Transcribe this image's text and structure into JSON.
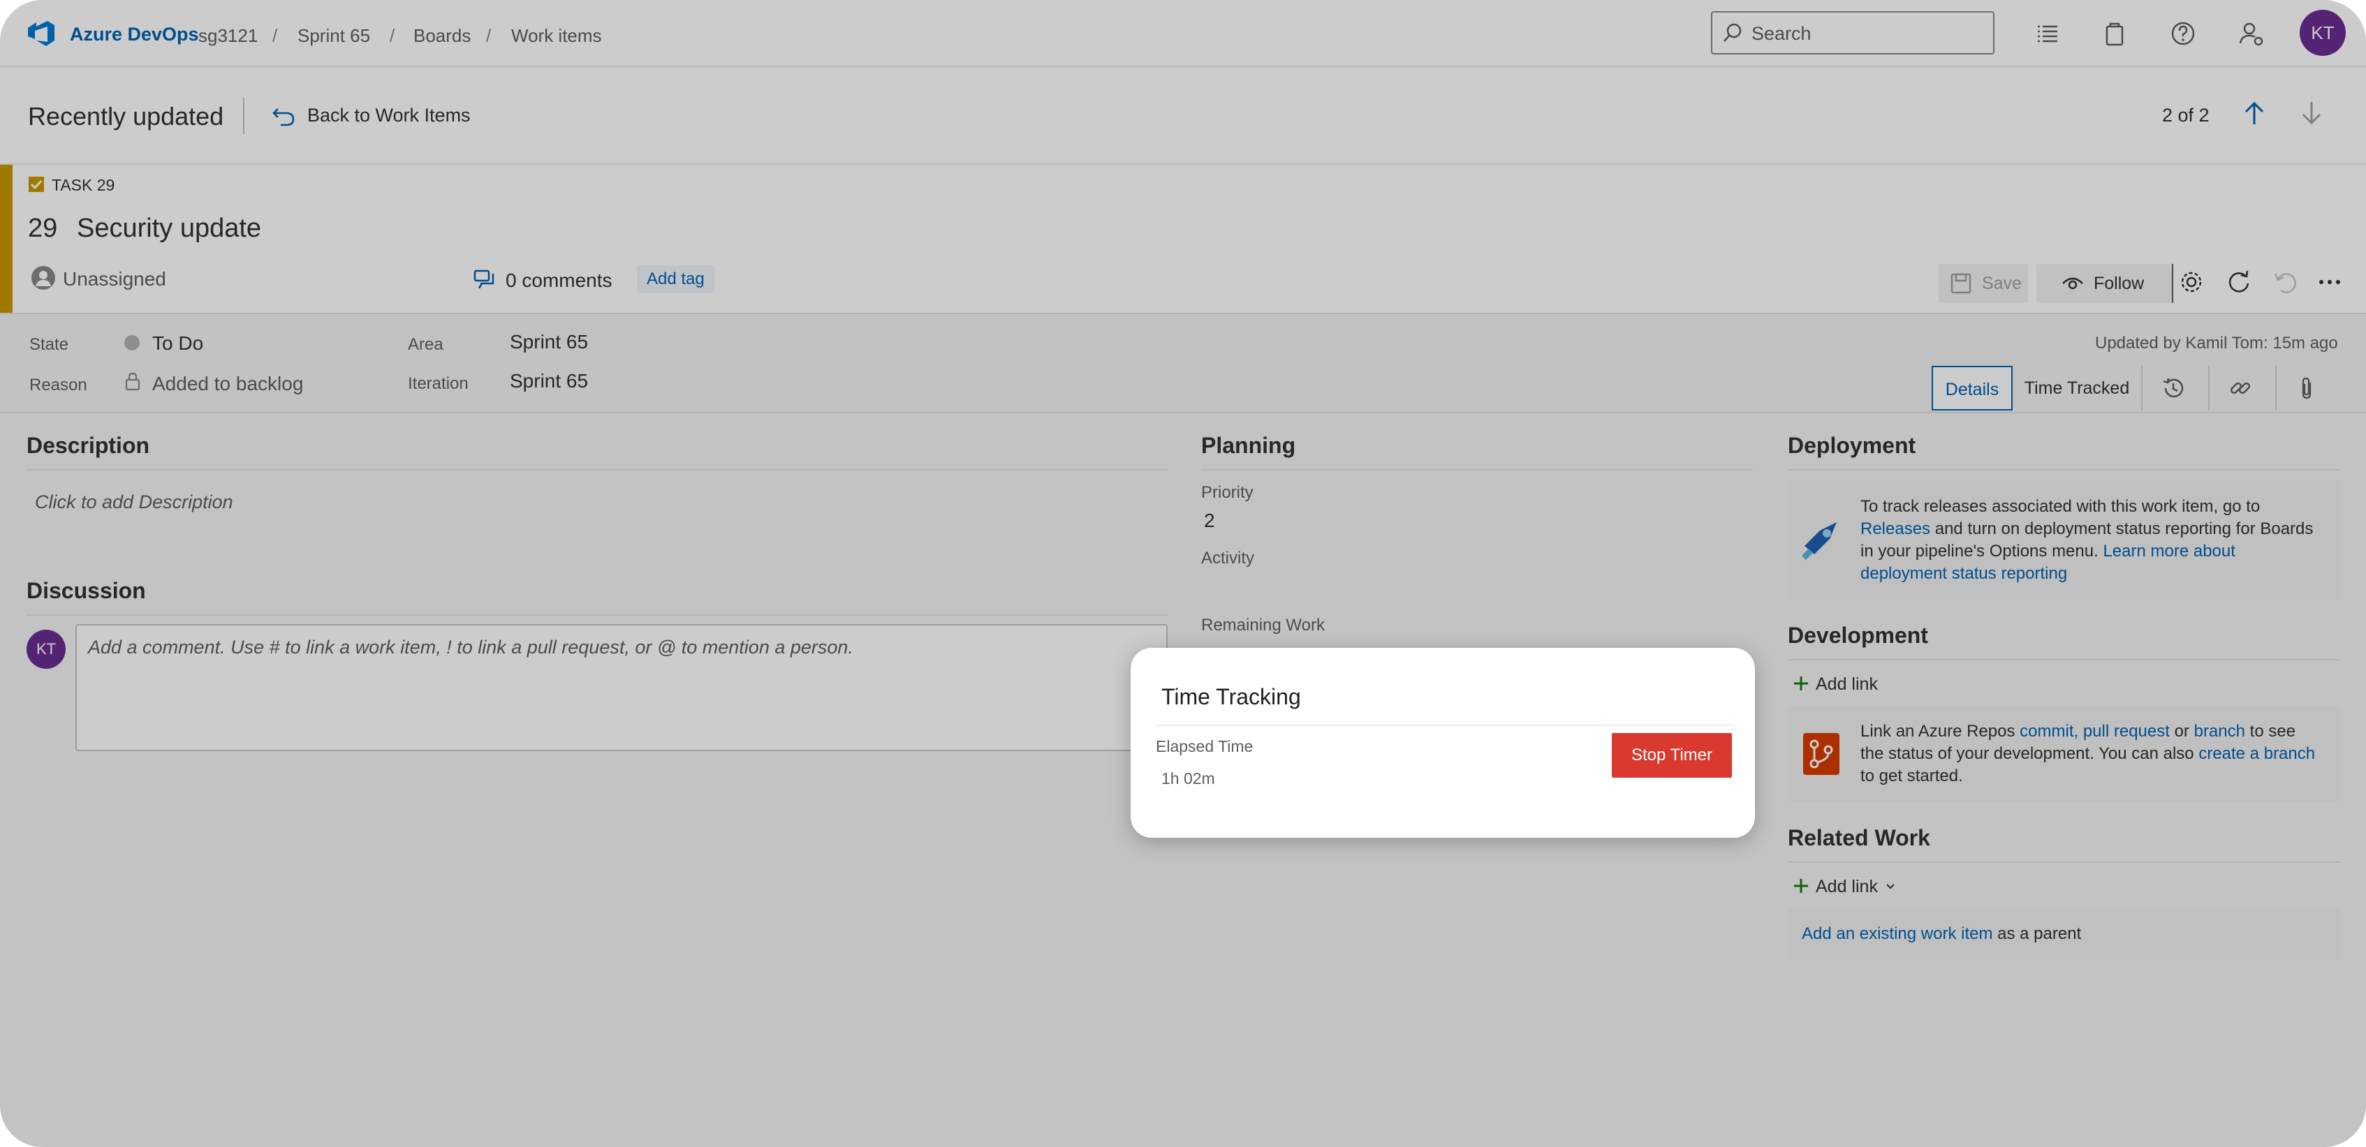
{
  "nav": {
    "brand": "Azure DevOps",
    "breadcrumbs": [
      "sg3121",
      "Sprint 65",
      "Boards",
      "Work items"
    ],
    "search_placeholder": "Search",
    "avatar_initials": "KT"
  },
  "recent": {
    "title": "Recently updated",
    "back_label": "Back to Work Items",
    "pager": "2 of 2"
  },
  "work_item": {
    "type_label": "TASK 29",
    "id": "29",
    "title": "Security update",
    "assignee": "Unassigned",
    "comments": "0 comments",
    "add_tag": "Add tag",
    "save_label": "Save",
    "follow_label": "Follow"
  },
  "fields": {
    "state_label": "State",
    "state_value": "To Do",
    "reason_label": "Reason",
    "reason_value": "Added to backlog",
    "area_label": "Area",
    "area_value": "Sprint 65",
    "iteration_label": "Iteration",
    "iteration_value": "Sprint 65",
    "updated_by": "Updated by Kamil Tom: 15m ago"
  },
  "tabs": {
    "details": "Details",
    "time_tracked": "Time Tracked"
  },
  "description": {
    "title": "Description",
    "placeholder": "Click to add Description"
  },
  "discussion": {
    "title": "Discussion",
    "avatar_initials": "KT",
    "placeholder": "Add a comment. Use # to link a work item, ! to link a pull request, or @ to mention a person."
  },
  "planning": {
    "title": "Planning",
    "priority_label": "Priority",
    "priority_value": "2",
    "activity_label": "Activity",
    "remaining_label": "Remaining Work"
  },
  "deployment": {
    "title": "Deployment",
    "text_1": "To track releases associated with this work item, go to",
    "link_releases": "Releases",
    "text_2": "and turn on deployment status reporting for Boards",
    "text_3": "in your pipeline's Options menu.",
    "link_learn_1": "Learn more about",
    "link_learn_2": "deployment status reporting"
  },
  "development": {
    "title": "Development",
    "add_link": "Add link",
    "text_1": "Link an Azure Repos",
    "link_commit": "commit,",
    "link_pr": "pull request",
    "text_or": "or",
    "link_branch": "branch",
    "text_2": "to see",
    "text_3": "the status of your development. You can also",
    "link_create": "create a branch",
    "text_4": "to get started."
  },
  "related": {
    "title": "Related Work",
    "add_link": "Add link",
    "link_existing": "Add an existing work item",
    "text_parent": "as a parent"
  },
  "modal": {
    "title": "Time Tracking",
    "elapsed_label": "Elapsed Time",
    "elapsed_value": "1h 02m",
    "stop_label": "Stop Timer"
  },
  "colors": {
    "accent": "#0062b2",
    "task_yellow": "#c89900",
    "stop_red": "#d9392e",
    "avatar_purple": "#6a2c91"
  }
}
